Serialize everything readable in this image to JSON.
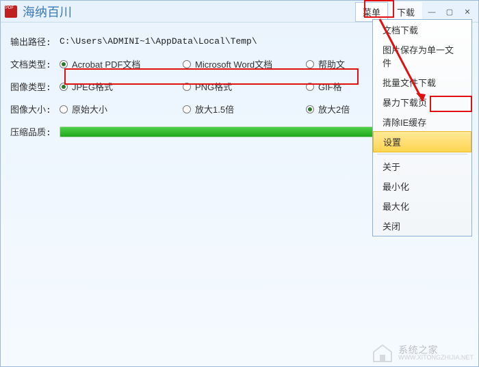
{
  "app": {
    "title": "海纳百川"
  },
  "menubar": {
    "menu_label": "菜单",
    "download_label": "下载"
  },
  "form": {
    "output_path_label": "输出路径:",
    "output_path_value": "C:\\Users\\ADMINI~1\\AppData\\Local\\Temp\\",
    "doc_type_label": "文档类型:",
    "doc_types": {
      "pdf": "Acrobat PDF文档",
      "word": "Microsoft Word文档",
      "help": "帮助文"
    },
    "image_type_label": "图像类型:",
    "image_types": {
      "jpeg": "JPEG格式",
      "png": "PNG格式",
      "gif": "GIF格"
    },
    "image_size_label": "图像大小:",
    "image_sizes": {
      "orig": "原始大小",
      "x15": "放大1.5倍",
      "x2": "放大2倍"
    },
    "quality_label": "压缩品质:"
  },
  "dropdown": {
    "doc_download": "文档下载",
    "save_single": "图片保存为单一文件",
    "batch_dl": "批量文件下载",
    "force_dl": "暴力下载页",
    "clear_ie": "清除IE缓存",
    "settings": "设置",
    "about": "关于",
    "minimize": "最小化",
    "maximize": "最大化",
    "close": "关闭"
  },
  "watermark": {
    "title": "系统之家",
    "url": "WWW.XITONGZHIJIA.NET"
  }
}
